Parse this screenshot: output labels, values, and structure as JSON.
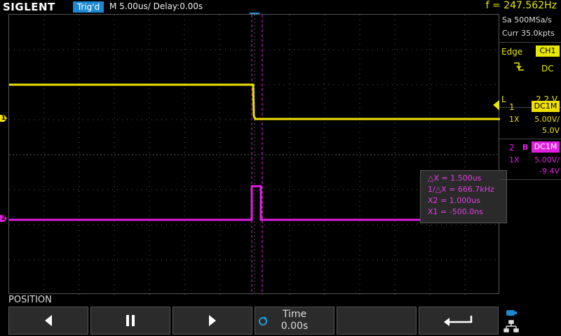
{
  "header": {
    "brand": "SIGLENT",
    "trigger_status": "Trig'd",
    "timebase": "M 5.00us/",
    "delay": "Delay:0.00s",
    "frequency": "f = 247.562Hz"
  },
  "acquisition": {
    "sample_rate": "Sa 500MSa/s",
    "memory": "Curr 35.0kpts"
  },
  "trigger": {
    "type": "Edge",
    "source": "CH1",
    "coupling": "DC",
    "level_label": "L",
    "level": "2.2 V"
  },
  "channels": [
    {
      "number": "1",
      "bw": "",
      "coupling": "DC1M",
      "probe": "1X",
      "scale": "5.00V/",
      "offset": "5.0V",
      "color": "#f0e000"
    },
    {
      "number": "2",
      "bw": "B",
      "coupling": "DC1M",
      "probe": "1X",
      "scale": "5.00V/",
      "offset": "-9.4V",
      "color": "#e020e0"
    }
  ],
  "markers": {
    "ch1": "1",
    "ch2": "2"
  },
  "cursors": {
    "delta_x": "△X = 1.500us",
    "inv_delta_x": "1/△X = 666.7kHz",
    "x2": "X2 = 1.000us",
    "x1": "X1 = -500.0ns"
  },
  "menu": {
    "title": "POSITION",
    "time_label": "Time",
    "time_value": "0.00s",
    "icons": [
      "left-arrow-icon",
      "pause-icon",
      "right-arrow-icon",
      "knob-icon",
      "return-icon"
    ]
  },
  "colors": {
    "ch1": "#f0e000",
    "ch2": "#e020e0",
    "accent": "#1e88d2",
    "grid": "#5a5a5a"
  }
}
